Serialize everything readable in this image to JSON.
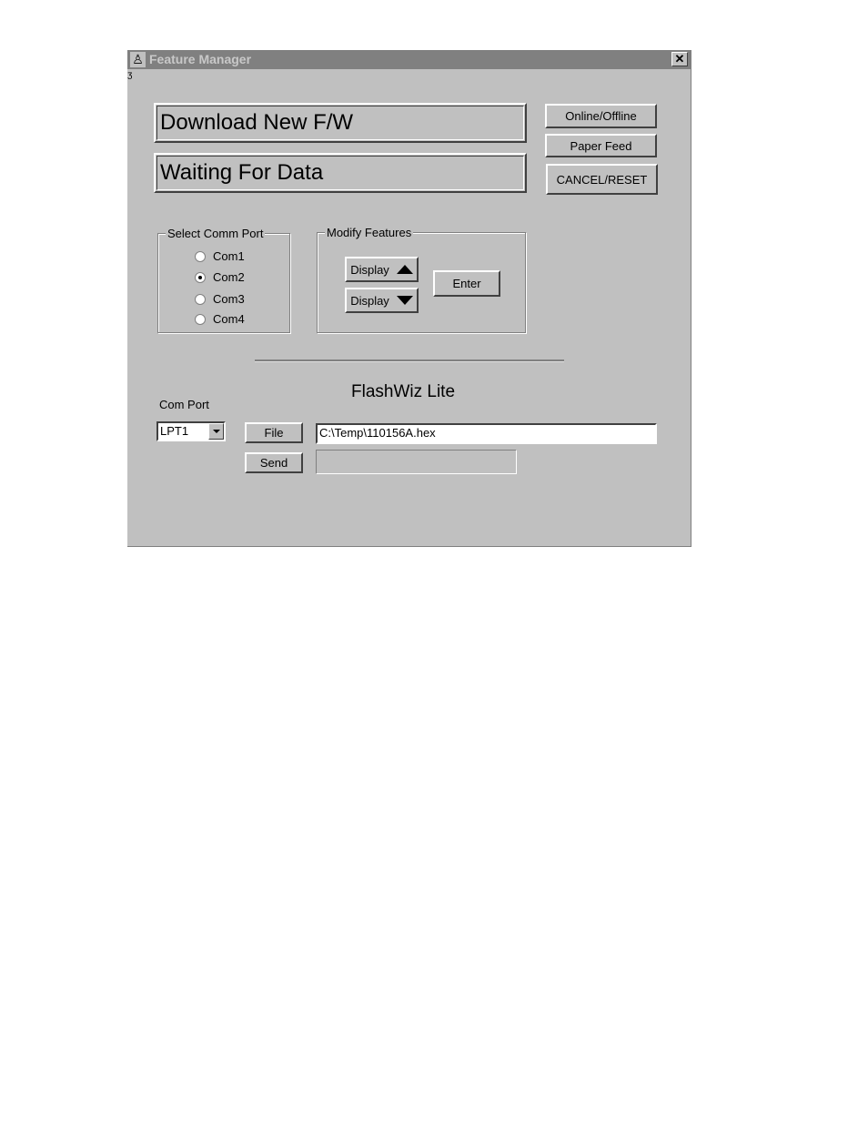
{
  "window": {
    "title": "Feature Manager",
    "app_icon": "printer-man-icon",
    "close_label": "✕"
  },
  "status": {
    "line1": "Download New F/W",
    "line2": "Waiting For Data"
  },
  "side_buttons": {
    "online_offline": "Online/Offline",
    "paper_feed": "Paper Feed",
    "cancel_reset": "CANCEL/RESET"
  },
  "comm_port_group": {
    "label": "Select Comm Port",
    "options": [
      {
        "label": "Com1",
        "checked": false
      },
      {
        "label": "Com2",
        "checked": true
      },
      {
        "label": "Com3",
        "checked": false
      },
      {
        "label": "Com4",
        "checked": false
      }
    ]
  },
  "modify_features": {
    "label": "Modify Features",
    "display_up": "Display",
    "display_down": "Display",
    "enter": "Enter"
  },
  "flashwiz": {
    "heading": "FlashWiz Lite",
    "com_port_label": "Com Port",
    "com_port_value": "LPT1",
    "file_button": "File",
    "send_button": "Send",
    "file_path": "C:\\Temp\\110156A.hex",
    "progress": 0
  }
}
